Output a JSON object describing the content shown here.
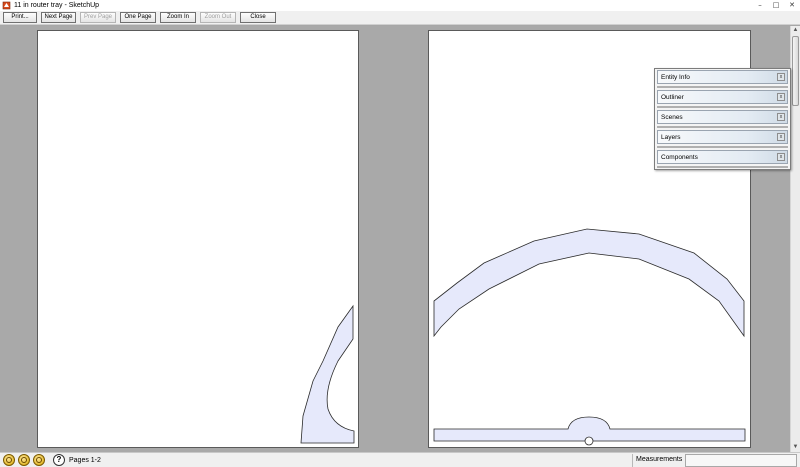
{
  "window": {
    "title": "11 in router tray - SketchUp",
    "controls": [
      "–",
      "□",
      "✕"
    ]
  },
  "toolbar": {
    "print": "Print...",
    "next_page": "Next Page",
    "prev_page": "Prev Page",
    "one_page": "One Page",
    "zoom_in": "Zoom In",
    "zoom_out": "Zoom Out",
    "close": "Close"
  },
  "tray": {
    "panels": [
      {
        "label": "Entity Info"
      },
      {
        "label": "Outliner"
      },
      {
        "label": "Scenes"
      },
      {
        "label": "Layers"
      },
      {
        "label": "Components"
      }
    ],
    "close_glyph": "x"
  },
  "statusbar": {
    "icons": [
      "geo-location-icon",
      "credits-icon",
      "user-icon"
    ],
    "help_glyph": "?",
    "pages": "Pages 1-2",
    "measurements_label": "Measurements",
    "measurements_value": ""
  },
  "colors": {
    "shape_fill": "#e6e9fb",
    "shape_stroke": "#2a2a2a",
    "preview_bg": "#a9a9a9"
  }
}
